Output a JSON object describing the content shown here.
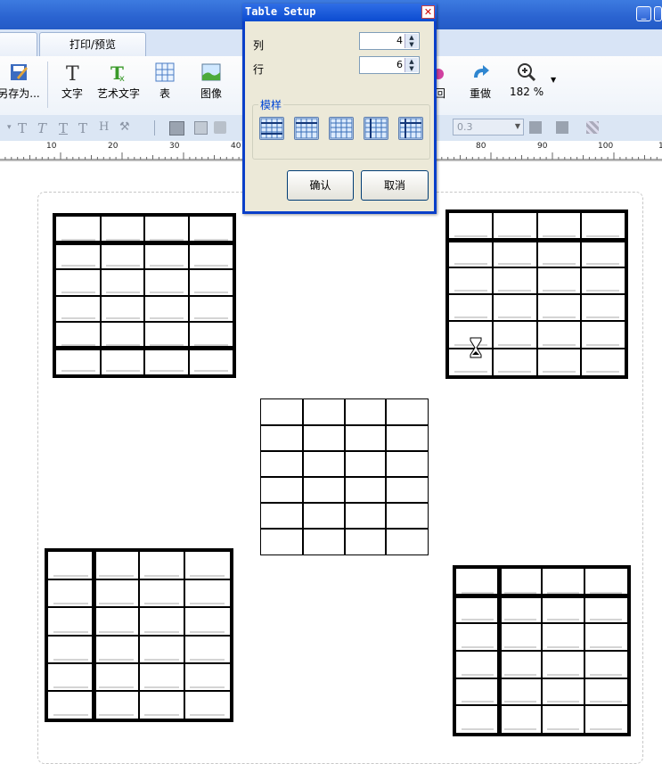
{
  "window": {
    "title_bar_color": "#2a63d0"
  },
  "tabs": [
    {
      "label": ""
    },
    {
      "label": "打印/预览"
    }
  ],
  "ribbon": {
    "save_as": "另存为...",
    "text": "文字",
    "art_text": "艺术文字",
    "table": "表",
    "image": "图像",
    "undo_partial": "回",
    "redo": "重做",
    "zoom": "182 %"
  },
  "format_bar": {
    "line_width_value": "0.3"
  },
  "ruler": {
    "labels": [
      "10",
      "20",
      "30",
      "40",
      "80",
      "90",
      "100",
      "1"
    ]
  },
  "dialog": {
    "title": "Table Setup",
    "columns_label": "列",
    "columns_value": "4",
    "rows_label": "行",
    "rows_value": "6",
    "styles_label": "模样",
    "ok": "确认",
    "cancel": "取消"
  },
  "tables": [
    {
      "style": "header-footer-bold",
      "rows": 6,
      "cols": 4
    },
    {
      "style": "header-bold",
      "rows": 6,
      "cols": 4
    },
    {
      "style": "plain",
      "rows": 6,
      "cols": 4
    },
    {
      "style": "firstcol-bold",
      "rows": 6,
      "cols": 4
    },
    {
      "style": "header-firstcol-bold",
      "rows": 6,
      "cols": 4
    }
  ]
}
